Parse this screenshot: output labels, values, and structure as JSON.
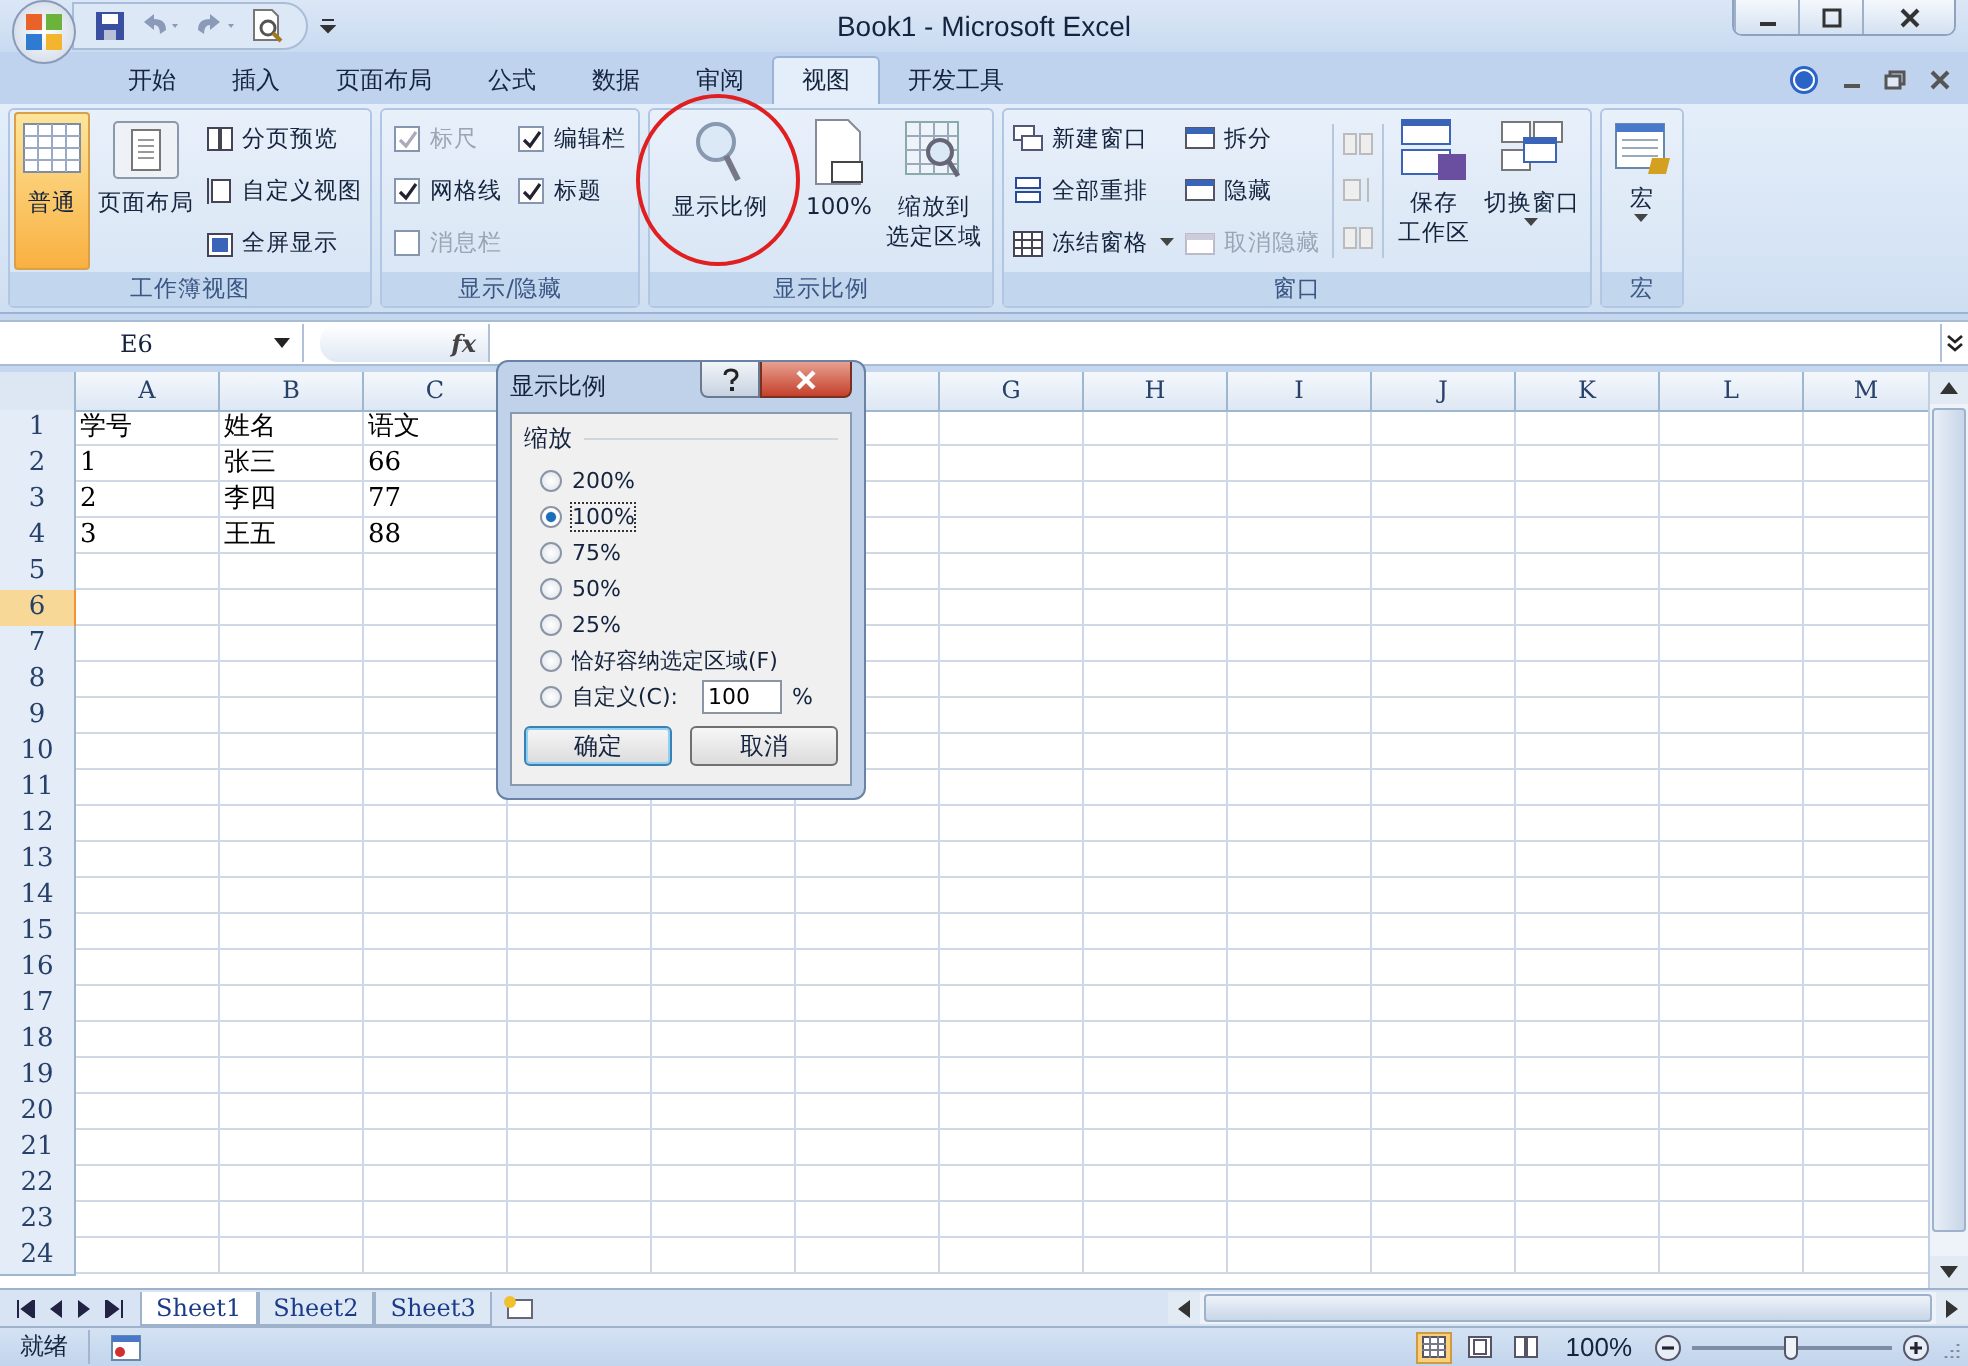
{
  "title_bar": {
    "title": "Book1 - Microsoft Excel"
  },
  "ribbon_tabs": [
    {
      "label": "开始",
      "selected": false
    },
    {
      "label": "插入",
      "selected": false
    },
    {
      "label": "页面布局",
      "selected": false
    },
    {
      "label": "公式",
      "selected": false
    },
    {
      "label": "数据",
      "selected": false
    },
    {
      "label": "审阅",
      "selected": false
    },
    {
      "label": "视图",
      "selected": true
    },
    {
      "label": "开发工具",
      "selected": false
    }
  ],
  "ribbon": {
    "workbook_views": {
      "label": "工作簿视图",
      "normal": {
        "label": "普通",
        "selected": true
      },
      "page_layout": {
        "label": "页面布局",
        "selected": false
      },
      "page_break_preview": "分页预览",
      "custom_views": "自定义视图",
      "full_screen": "全屏显示"
    },
    "show_hide": {
      "label": "显示/隐藏",
      "checkboxes": [
        {
          "label": "标尺",
          "checked": true,
          "disabled": true
        },
        {
          "label": "编辑栏",
          "checked": true,
          "disabled": false
        },
        {
          "label": "网格线",
          "checked": true,
          "disabled": false
        },
        {
          "label": "标题",
          "checked": true,
          "disabled": false
        },
        {
          "label": "消息栏",
          "checked": false,
          "disabled": true
        }
      ]
    },
    "zoom": {
      "label": "显示比例",
      "zoom": "显示比例",
      "hundred": "100%",
      "zoom_to_selection": [
        "缩放到",
        "选定区域"
      ]
    },
    "window": {
      "label": "窗口",
      "new_window": "新建窗口",
      "arrange_all": "全部重排",
      "freeze_panes": "冻结窗格",
      "split": {
        "label": "拆分",
        "disabled": false
      },
      "hide": {
        "label": "隐藏",
        "disabled": false
      },
      "unhide": {
        "label": "取消隐藏",
        "disabled": true
      },
      "save_workspace": [
        "保存",
        "工作区"
      ],
      "switch_windows": "切换窗口"
    },
    "macros": {
      "label": "宏",
      "macros": "宏"
    }
  },
  "formula_bar": {
    "name_box": "E6",
    "fx": "fx"
  },
  "columns_left": [
    "A",
    "B",
    "C"
  ],
  "columns_right": [
    "G",
    "H",
    "I",
    "J",
    "K",
    "L",
    "M"
  ],
  "rows": [
    {
      "header": "1",
      "selected": false,
      "cells": [
        "学号",
        "姓名",
        "语文"
      ]
    },
    {
      "header": "2",
      "selected": false,
      "cells": [
        "1",
        "张三",
        "66"
      ]
    },
    {
      "header": "3",
      "selected": false,
      "cells": [
        "2",
        "李四",
        "77"
      ]
    },
    {
      "header": "4",
      "selected": false,
      "cells": [
        "3",
        "王五",
        "88"
      ]
    },
    {
      "header": "5",
      "selected": false,
      "cells": []
    },
    {
      "header": "6",
      "selected": true,
      "cells": []
    },
    {
      "header": "7",
      "selected": false,
      "cells": []
    },
    {
      "header": "8",
      "selected": false,
      "cells": []
    },
    {
      "header": "9",
      "selected": false,
      "cells": []
    },
    {
      "header": "10",
      "selected": false,
      "cells": []
    },
    {
      "header": "11",
      "selected": false,
      "cells": []
    },
    {
      "header": "12",
      "selected": false,
      "cells": []
    },
    {
      "header": "13",
      "selected": false,
      "cells": []
    },
    {
      "header": "14",
      "selected": false,
      "cells": []
    },
    {
      "header": "15",
      "selected": false,
      "cells": []
    },
    {
      "header": "16",
      "selected": false,
      "cells": []
    },
    {
      "header": "17",
      "selected": false,
      "cells": []
    },
    {
      "header": "18",
      "selected": false,
      "cells": []
    },
    {
      "header": "19",
      "selected": false,
      "cells": []
    },
    {
      "header": "20",
      "selected": false,
      "cells": []
    },
    {
      "header": "21",
      "selected": false,
      "cells": []
    },
    {
      "header": "22",
      "selected": false,
      "cells": []
    },
    {
      "header": "23",
      "selected": false,
      "cells": []
    },
    {
      "header": "24",
      "selected": false,
      "cells": []
    }
  ],
  "sheet_tabs": [
    {
      "label": "Sheet1",
      "selected": true
    },
    {
      "label": "Sheet2",
      "selected": false
    },
    {
      "label": "Sheet3",
      "selected": false
    }
  ],
  "status_bar": {
    "status": "就绪",
    "view_buttons": [
      {
        "selected": true
      },
      {
        "selected": false
      },
      {
        "selected": false
      }
    ],
    "zoom_text": "100%",
    "zoom_slider": {
      "level": 0.5
    }
  },
  "dialog": {
    "title": "显示比例",
    "group_label": "缩放",
    "options": [
      {
        "label": "200%",
        "selected": false
      },
      {
        "label": "100%",
        "selected": true
      },
      {
        "label": "75%",
        "selected": false
      },
      {
        "label": "50%",
        "selected": false
      },
      {
        "label": "25%",
        "selected": false
      },
      {
        "label": "恰好容纳选定区域(F)",
        "selected": false
      },
      {
        "label": "自定义(C):",
        "selected": false,
        "kind": "custom"
      }
    ],
    "custom_value": "100",
    "percent_sign": "%",
    "buttons": [
      "确定",
      "取消"
    ]
  }
}
